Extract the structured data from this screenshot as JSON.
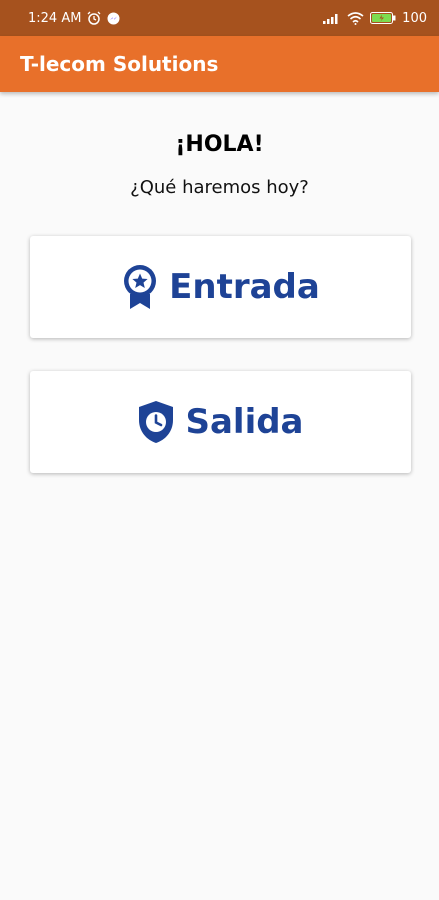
{
  "status_bar": {
    "time": "1:24 AM",
    "battery": "100"
  },
  "app_bar": {
    "title": "T-lecom Solutions"
  },
  "main": {
    "greeting": "¡HOLA!",
    "question": "¿Qué haremos hoy?"
  },
  "cards": [
    {
      "label": "Entrada",
      "icon": "badge-star-icon"
    },
    {
      "label": "Salida",
      "icon": "shield-clock-icon"
    }
  ],
  "colors": {
    "status_bar": "#a6521e",
    "app_bar": "#e8702a",
    "primary_blue": "#1e4396",
    "background": "#fafafa"
  }
}
